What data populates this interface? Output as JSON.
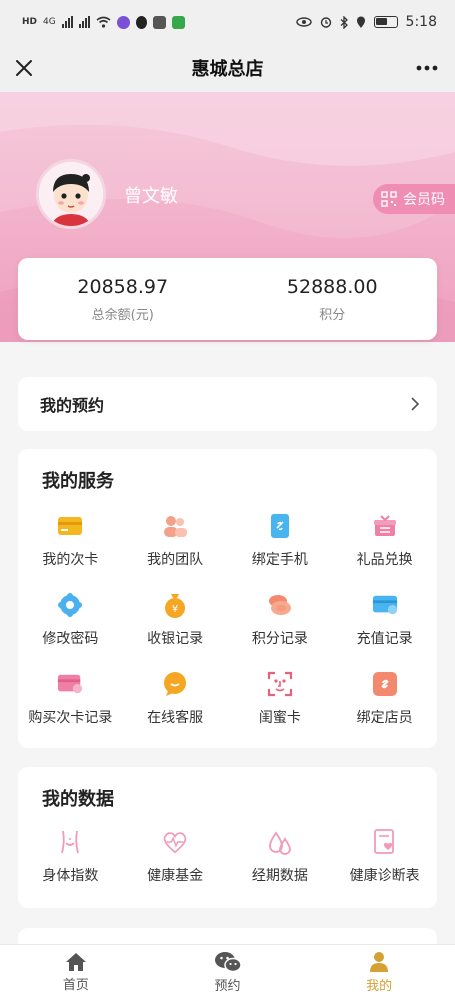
{
  "status_bar": {
    "time": "5:18",
    "left_labels": [
      "HD",
      "HD"
    ],
    "network": "4G"
  },
  "header": {
    "title": "惠城总店"
  },
  "profile": {
    "name": "曾文敏",
    "member_code_label": "会员码"
  },
  "balance": {
    "total_value": "20858.97",
    "total_label": "总余额(元)",
    "points_value": "52888.00",
    "points_label": "积分"
  },
  "booking": {
    "label": "我的预约"
  },
  "services": {
    "title": "我的服务",
    "items": [
      {
        "label": "我的次卡",
        "icon": "card-icon",
        "color": "#f5b71f"
      },
      {
        "label": "我的团队",
        "icon": "team-icon",
        "color": "#f4a18a"
      },
      {
        "label": "绑定手机",
        "icon": "phone-link-icon",
        "color": "#48b5f0"
      },
      {
        "label": "礼品兑换",
        "icon": "gift-icon",
        "color": "#f07fa6"
      },
      {
        "label": "修改密码",
        "icon": "gear-icon",
        "color": "#4ab0ef"
      },
      {
        "label": "收银记录",
        "icon": "money-bag-icon",
        "color": "#f5a623"
      },
      {
        "label": "积分记录",
        "icon": "coins-icon",
        "color": "#f38a70"
      },
      {
        "label": "充值记录",
        "icon": "recharge-card-icon",
        "color": "#48b5f0"
      },
      {
        "label": "购买次卡记录",
        "icon": "purchase-card-icon",
        "color": "#f07fa6"
      },
      {
        "label": "在线客服",
        "icon": "chat-bubble-icon",
        "color": "#f5a623"
      },
      {
        "label": "闺蜜卡",
        "icon": "face-scan-icon",
        "color": "#e8627a"
      },
      {
        "label": "绑定店员",
        "icon": "link-icon",
        "color": "#f38a70"
      }
    ]
  },
  "data_section": {
    "title": "我的数据",
    "items": [
      {
        "label": "身体指数",
        "icon": "body-icon",
        "color": "#f29ab8"
      },
      {
        "label": "健康基金",
        "icon": "heart-pulse-icon",
        "color": "#f29ab8"
      },
      {
        "label": "经期数据",
        "icon": "droplets-icon",
        "color": "#f29ab8"
      },
      {
        "label": "健康诊断表",
        "icon": "health-report-icon",
        "color": "#f29ab8"
      }
    ]
  },
  "bottom_nav": {
    "items": [
      {
        "label": "首页",
        "icon": "home-icon"
      },
      {
        "label": "预约",
        "icon": "wechat-icon"
      },
      {
        "label": "我的",
        "icon": "user-icon"
      }
    ],
    "active_color": "#d4a234",
    "inactive_color": "#555555"
  }
}
